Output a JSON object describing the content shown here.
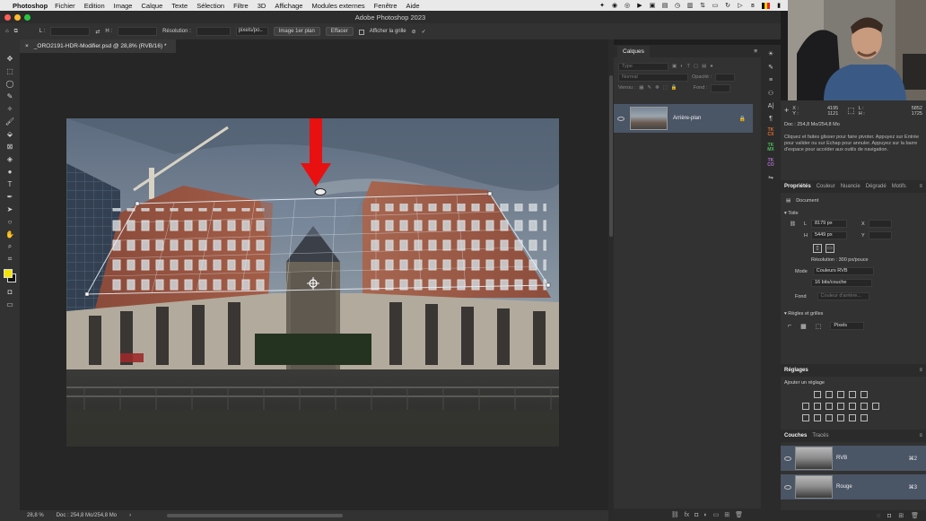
{
  "menubar": {
    "app": "Photoshop",
    "items": [
      "Fichier",
      "Edition",
      "Image",
      "Calque",
      "Texte",
      "Sélection",
      "Filtre",
      "3D",
      "Affichage",
      "Modules externes",
      "Fenêtre",
      "Aide"
    ]
  },
  "window": {
    "title": "Adobe Photoshop 2023"
  },
  "options": {
    "l_label": "L :",
    "h_label": "H :",
    "resolution_label": "Résolution :",
    "unit_select": "pixels/po..",
    "front_image_button": "Image 1er plan",
    "clear_button": "Effacer",
    "show_grid_label": "Afficher la grille"
  },
  "document": {
    "tab_title": "_ORO2191-HDR-Modifier.psd @ 28,8% (RVB/16) *",
    "zoom": "28,8 %",
    "doc_info": "Doc : 254,8 Mo/254,8 Mo"
  },
  "layers_panel": {
    "tab": "Calques",
    "search_placeholder": "Type",
    "blend_mode": "Normal",
    "opacity_label": "Opacité :",
    "lock_label": "Verrou :",
    "fill_label": "Fond :",
    "layer_name": "Arrière-plan"
  },
  "info_panel": {
    "x_label": "X :",
    "y_label": "Y :",
    "x_value": "4195",
    "y_value": "1121",
    "l_label": "L :",
    "h_label": "H :",
    "l_value": "5852",
    "h_value": "1725",
    "doc": "Doc : 254,8 Mo/254,8 Mo",
    "hint": "Cliquez et faites glisser pour faire pivoter. Appuyez sur Entrée pour valider ou sur Echap pour annuler. Appuyez sur la barre d'espace pour accéder aux outils de navigation."
  },
  "properties": {
    "tabs": [
      "Propriétés",
      "Couleur",
      "Nuancie",
      "Dégradé",
      "Motifs"
    ],
    "doc_label": "Document",
    "toile_heading": "Toile",
    "w_label": "L",
    "w_value": "8179 px",
    "h_label": "H",
    "h_value": "5449 px",
    "x_label": "X",
    "y_label": "Y",
    "resolution": "Résolution : 300 px/pouce",
    "mode_label": "Mode",
    "mode_value": "Couleurs RVB",
    "depth_value": "16 bits/couche",
    "fond_label": "Fond",
    "fond_value": "Couleur d'arrière...",
    "rulers_heading": "Règles et grilles",
    "rulers_unit": "Pixels"
  },
  "adjustments": {
    "title": "Réglages",
    "add_label": "Ajouter un réglage"
  },
  "channels": {
    "tabs": [
      "Couches",
      "Tracés"
    ],
    "items": [
      {
        "name": "RVB",
        "shortcut": "⌘2"
      },
      {
        "name": "Rouge",
        "shortcut": "⌘3"
      }
    ]
  },
  "colors": {
    "foreground": "#f5e400",
    "background": "#111111",
    "arrow": "#e81010",
    "layer_selected": "#4a5566"
  }
}
